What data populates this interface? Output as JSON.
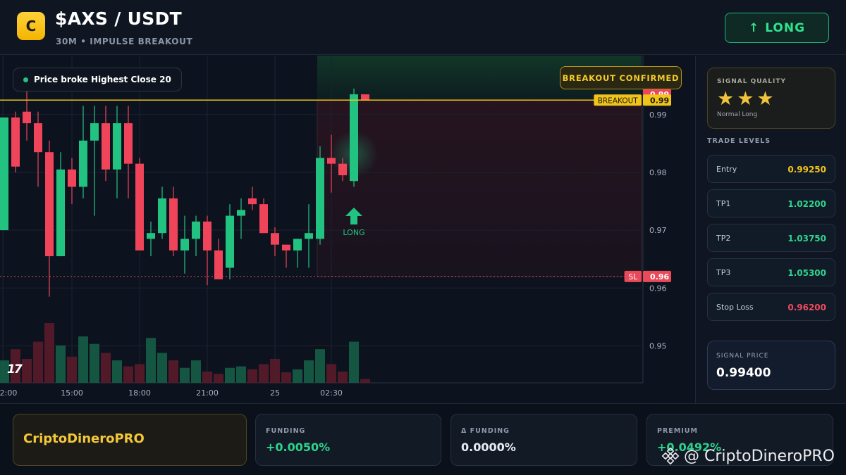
{
  "header": {
    "logo_letter": "C",
    "title": "$AXS / USDT",
    "subtitle": "30M • IMPULSE BREAKOUT",
    "direction_button": {
      "arrow": "↑",
      "label": "LONG"
    }
  },
  "chart": {
    "info_pill": "Price broke Highest Close 20",
    "badge": "BREAKOUT CONFIRMED",
    "tv_logo": "17",
    "signal_marker_label": "LONG",
    "breakout_label": "BREAKOUT",
    "sl_label": "SL",
    "colors": {
      "up": "#22c381",
      "down": "#ef4459",
      "breakout": "#f0c419",
      "sl": "#e84a5a"
    }
  },
  "chart_data": {
    "type": "candlestick",
    "x_tick_labels": [
      "2:00",
      "15:00",
      "18:00",
      "21:00",
      "25",
      "02:30"
    ],
    "y_tick_labels": [
      "0.99",
      "0.98",
      "0.97",
      "0.96",
      "0.95"
    ],
    "ylim": [
      0.9436,
      1.0002
    ],
    "price_tags": [
      {
        "value": 0.9935,
        "text": "0.99",
        "color": "#ef4459"
      },
      {
        "value": 0.9925,
        "text": "0.99",
        "color": "#f0c419",
        "label": "BREAKOUT"
      },
      {
        "value": 0.962,
        "text": "0.96",
        "color": "#e84a5a",
        "label": "SL"
      }
    ],
    "breakout_level": 0.9925,
    "sl_level": 0.962,
    "candles": [
      [
        0.97,
        0.983,
        0.972,
        0.9895,
        30
      ],
      [
        0.9895,
        0.9905,
        0.98,
        0.981,
        45
      ],
      [
        0.9905,
        0.9955,
        0.9855,
        0.9885,
        32
      ],
      [
        0.9885,
        0.9905,
        0.9775,
        0.9835,
        55
      ],
      [
        0.9835,
        0.9855,
        0.9585,
        0.9655,
        80
      ],
      [
        0.9655,
        0.9835,
        0.9655,
        0.9805,
        50
      ],
      [
        0.9805,
        0.9825,
        0.9745,
        0.9775,
        35
      ],
      [
        0.9775,
        0.9915,
        0.9755,
        0.9855,
        62
      ],
      [
        0.9855,
        0.9915,
        0.9725,
        0.9885,
        52
      ],
      [
        0.9885,
        0.9915,
        0.9785,
        0.9805,
        40
      ],
      [
        0.9805,
        0.9915,
        0.9755,
        0.9885,
        30
      ],
      [
        0.9885,
        0.9915,
        0.9755,
        0.9815,
        22
      ],
      [
        0.9815,
        0.9825,
        0.9705,
        0.9665,
        25
      ],
      [
        0.9685,
        0.9715,
        0.9655,
        0.9695,
        60
      ],
      [
        0.9695,
        0.9775,
        0.9685,
        0.9755,
        40
      ],
      [
        0.9755,
        0.9775,
        0.9655,
        0.9665,
        30
      ],
      [
        0.9665,
        0.9725,
        0.9625,
        0.9685,
        20
      ],
      [
        0.9685,
        0.9725,
        0.9655,
        0.9715,
        30
      ],
      [
        0.9715,
        0.9725,
        0.9605,
        0.9665,
        15
      ],
      [
        0.9665,
        0.9685,
        0.9625,
        0.9615,
        12
      ],
      [
        0.9635,
        0.9745,
        0.9615,
        0.9725,
        20
      ],
      [
        0.9725,
        0.9755,
        0.9685,
        0.9735,
        22
      ],
      [
        0.9755,
        0.9775,
        0.9735,
        0.9745,
        18
      ],
      [
        0.9745,
        0.9755,
        0.9695,
        0.9695,
        25
      ],
      [
        0.9695,
        0.9705,
        0.9655,
        0.9675,
        32
      ],
      [
        0.9675,
        0.9675,
        0.9635,
        0.9665,
        14
      ],
      [
        0.9665,
        0.9685,
        0.9635,
        0.9685,
        18
      ],
      [
        0.9685,
        0.9745,
        0.9635,
        0.9695,
        30
      ],
      [
        0.9685,
        0.9845,
        0.9675,
        0.9825,
        45
      ],
      [
        0.9825,
        0.9865,
        0.9765,
        0.9815,
        25
      ],
      [
        0.9815,
        0.9825,
        0.9785,
        0.9795,
        15
      ],
      [
        0.9785,
        0.9945,
        0.9775,
        0.9935,
        55
      ],
      [
        0.9935,
        0.9935,
        0.9925,
        0.9925,
        5
      ]
    ],
    "volume_max": 80
  },
  "panel": {
    "quality_title": "SIGNAL QUALITY",
    "stars": "★★★",
    "quality_sub": "Normal Long",
    "levels_title": "TRADE LEVELS",
    "levels": [
      {
        "label": "Entry",
        "value": "0.99250",
        "color": "#f0c419"
      },
      {
        "label": "TP1",
        "value": "1.02200",
        "color": "#2ed38c"
      },
      {
        "label": "TP2",
        "value": "1.03750",
        "color": "#2ed38c"
      },
      {
        "label": "TP3",
        "value": "1.05300",
        "color": "#2ed38c"
      },
      {
        "label": "Stop Loss",
        "value": "0.96200",
        "color": "#f04a5e"
      }
    ],
    "signal_price_title": "SIGNAL PRICE",
    "signal_price": "0.99400"
  },
  "footer": {
    "brand": "CriptoDineroPRO",
    "stats": [
      {
        "title": "FUNDING",
        "value": "+0.0050%",
        "color": "#2ed38c"
      },
      {
        "title": "Δ FUNDING",
        "value": "0.0000%",
        "color": "#e8edf5"
      },
      {
        "title": "PREMIUM",
        "value": "+0.0492%",
        "color": "#2ed38c"
      }
    ],
    "watermark": "@ CriptoDineroPRO"
  }
}
